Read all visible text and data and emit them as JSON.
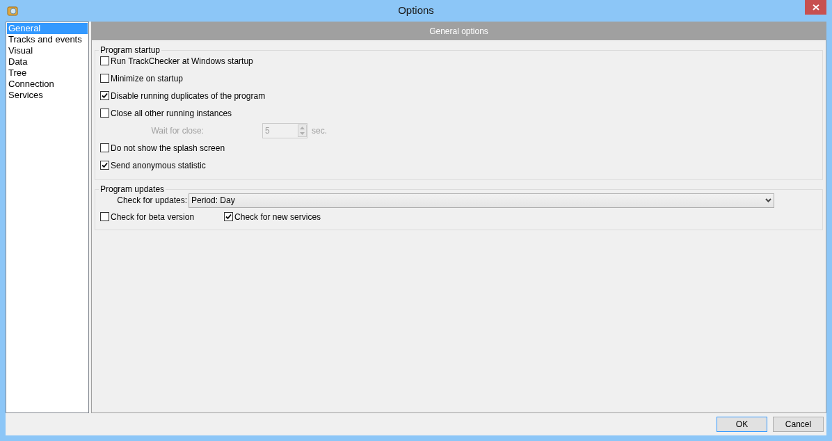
{
  "window": {
    "title": "Options"
  },
  "sidebar": {
    "items": [
      {
        "label": "General",
        "selected": true
      },
      {
        "label": "Tracks and events",
        "selected": false
      },
      {
        "label": "Visual",
        "selected": false
      },
      {
        "label": "Data",
        "selected": false
      },
      {
        "label": "Tree",
        "selected": false
      },
      {
        "label": "Connection",
        "selected": false
      },
      {
        "label": "Services",
        "selected": false
      }
    ]
  },
  "panel": {
    "title": "General options"
  },
  "startup": {
    "title": "Program startup",
    "rows": [
      {
        "kind": "checkbox",
        "label": "Run TrackChecker at Windows startup",
        "checked": false
      },
      {
        "kind": "checkbox",
        "label": "Minimize on startup",
        "checked": false
      },
      {
        "kind": "checkbox",
        "label": "Disable running duplicates of the program",
        "checked": true
      },
      {
        "kind": "checkbox",
        "label": "Close all other running instances",
        "checked": false
      },
      {
        "kind": "spin",
        "label": "Wait for close:",
        "value": "5",
        "unit": "sec.",
        "disabled": true
      },
      {
        "kind": "checkbox",
        "label": "Do not show the splash screen",
        "checked": false
      },
      {
        "kind": "checkbox",
        "label": "Send anonymous statistic",
        "checked": true
      }
    ]
  },
  "updates": {
    "title": "Program updates",
    "check_label": "Check for updates:",
    "check_value": "Period: Day",
    "options": [
      {
        "label": "Check for beta version",
        "checked": false
      },
      {
        "label": "Check for new services",
        "checked": true
      }
    ]
  },
  "buttons": [
    {
      "label": "OK",
      "default": true
    },
    {
      "label": "Cancel",
      "default": false
    }
  ]
}
